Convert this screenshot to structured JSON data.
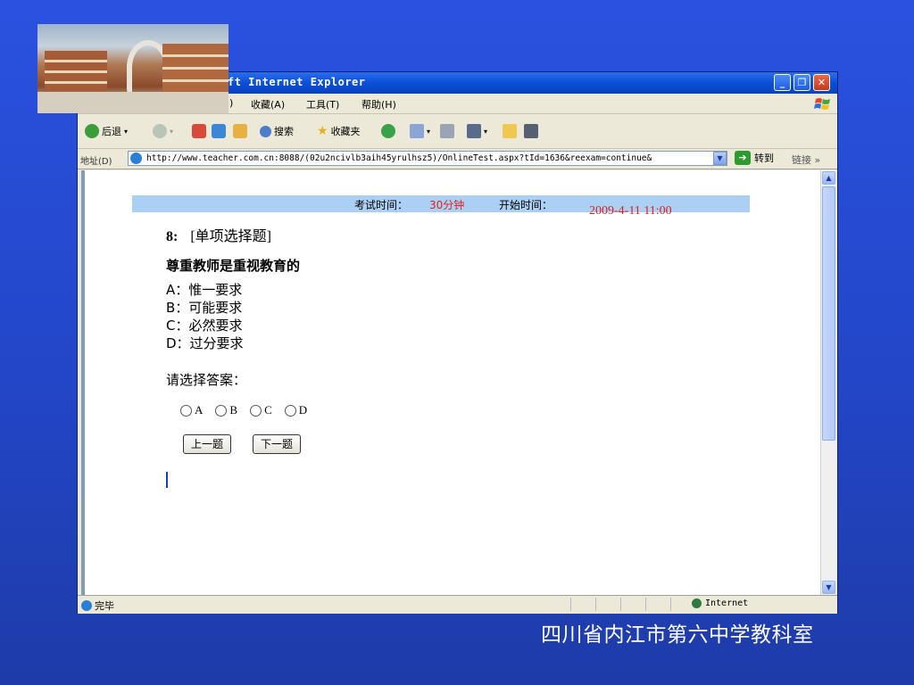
{
  "window": {
    "title_visible": "ft Internet Explorer",
    "buttons": {
      "minimize": "_",
      "maximize": "❐",
      "close": "✕"
    }
  },
  "menubar": {
    "items": [
      "收藏(A)",
      "工具(T)",
      "帮助(H)"
    ],
    "partial_item": ")"
  },
  "toolbar": {
    "back_label": "后退",
    "search_label": "搜索",
    "favorites_label": "收藏夹"
  },
  "addressbar": {
    "label": "地址(D)",
    "url": "http://www.teacher.com.cn:8088/(02u2ncivlb3aih45yrulhsz5)/OnlineTest.aspx?tId=1636&reexam=continue&",
    "go_label": "转到",
    "links_label": "链接"
  },
  "exam": {
    "time_label": "考试时间：",
    "time_value": "30分钟",
    "start_label": "开始时间：",
    "start_value": "2009-4-11   11:00",
    "question_number": "8:",
    "question_type": "[单项选择题]",
    "question_text": "尊重教师是重视教育的",
    "options": [
      "A：惟一要求",
      "B：可能要求",
      "C：必然要求",
      "D：过分要求"
    ],
    "prompt": "请选择答案：",
    "radio_labels": [
      "A",
      "B",
      "C",
      "D"
    ],
    "prev_button": "上一题",
    "next_button": "下一题"
  },
  "statusbar": {
    "status_text": "完毕",
    "zone_text": "Internet"
  },
  "footer": {
    "text": "四川省内江市第六中学教科室"
  },
  "colors": {
    "slide_background": "#2346c8",
    "exam_bar": "#abd0f3",
    "highlight_red": "#e02020"
  },
  "icons": [
    "back-icon",
    "forward-icon",
    "stop-icon",
    "refresh-icon",
    "home-icon",
    "search-icon",
    "favorites-icon",
    "history-icon",
    "mail-icon",
    "print-icon",
    "ie-icon",
    "go-icon",
    "globe-icon",
    "windows-flag-icon"
  ]
}
